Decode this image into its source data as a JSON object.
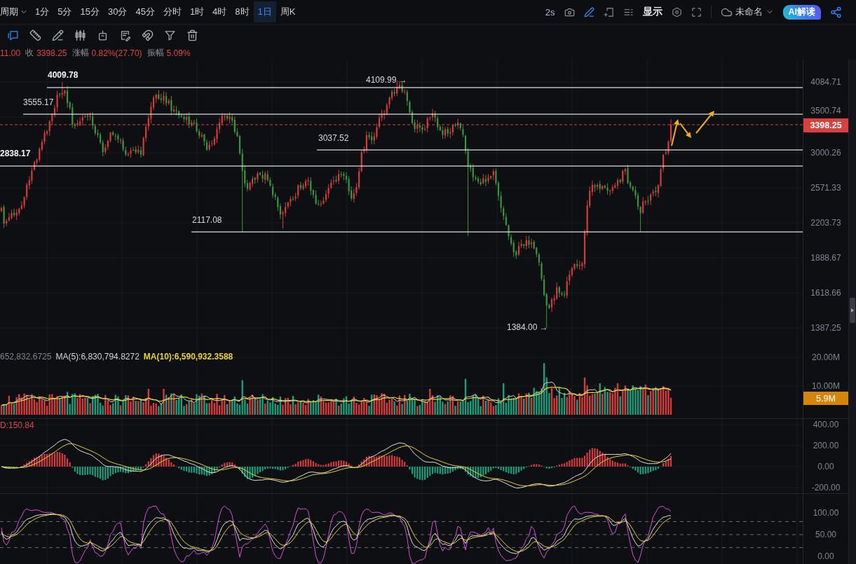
{
  "top_bar": {
    "period_menu": "周期",
    "intervals": [
      {
        "label": "1分",
        "selected": false
      },
      {
        "label": "5分",
        "selected": false
      },
      {
        "label": "15分",
        "selected": false
      },
      {
        "label": "30分",
        "selected": false
      },
      {
        "label": "45分",
        "selected": false
      },
      {
        "label": "分时",
        "selected": false
      },
      {
        "label": "1时",
        "selected": false
      },
      {
        "label": "4时",
        "selected": false
      },
      {
        "label": "8时",
        "selected": false
      },
      {
        "label": "1日",
        "selected": true
      },
      {
        "label": "周K",
        "selected": false
      }
    ],
    "refresh_interval": "2s",
    "tools": [
      {
        "kind": "camera",
        "active": false
      },
      {
        "kind": "pen",
        "active": true
      },
      {
        "kind": "frame",
        "active": false
      },
      {
        "kind": "list",
        "active": false
      }
    ],
    "display_menu": "显示",
    "layout_menu": "未命名",
    "ai_button": "AI解读"
  },
  "drawing_tools": [
    {
      "kind": "bubble",
      "selected": true
    },
    {
      "kind": "ruler",
      "selected": false
    },
    {
      "kind": "pencil",
      "selected": false
    },
    {
      "kind": "candles",
      "selected": false
    },
    {
      "kind": "box",
      "selected": false
    },
    {
      "kind": "note",
      "selected": false
    },
    {
      "kind": "magnet",
      "selected": false
    },
    {
      "kind": "filter",
      "selected": false
    },
    {
      "kind": "trash",
      "selected": false
    }
  ],
  "quote": [
    {
      "value": "11.00"
    },
    {
      "label": "收",
      "value": "3398.25"
    },
    {
      "label": "涨幅",
      "value": "0.82%(27.70)"
    },
    {
      "label": "振幅",
      "value": "5.09%"
    }
  ],
  "price_chart": {
    "levels": [
      {
        "label": "4009.78"
      },
      {
        "label": "3555.17"
      },
      {
        "label": "3037.52"
      },
      {
        "label": "2838.17"
      },
      {
        "label": "2117.08"
      }
    ],
    "extremes": [
      {
        "label": "4109.99",
        "arrow": "→"
      },
      {
        "label": "1384.00",
        "arrow": "→"
      }
    ],
    "axis_labels": [
      "4084.71",
      "3500.74",
      "3000.26",
      "2571.33",
      "2203.73",
      "1888.67",
      "1618.66",
      "1387.25"
    ],
    "last_price": "3398.25"
  },
  "volume_chart": {
    "legend": [
      {
        "text": "652,832.6725",
        "color": "#7d8089"
      },
      {
        "text": "MA(5):6,830,794.8272",
        "color": "#d2d3d6"
      },
      {
        "text": "MA(10):6,590,932.3588",
        "color": "#e8d62a"
      }
    ],
    "axis_labels": [
      "20.00M",
      "10.00M"
    ],
    "last_value": "5.9M"
  },
  "macd_chart": {
    "legend": [
      {
        "text": "D:150.84",
        "color": "#d9474a"
      }
    ],
    "axis_labels": [
      "400.00",
      "200.00",
      "0.00",
      "-200.00"
    ]
  },
  "oscillator_chart": {
    "axis_labels": [
      "100.00",
      "50.00",
      "0.00"
    ]
  }
}
